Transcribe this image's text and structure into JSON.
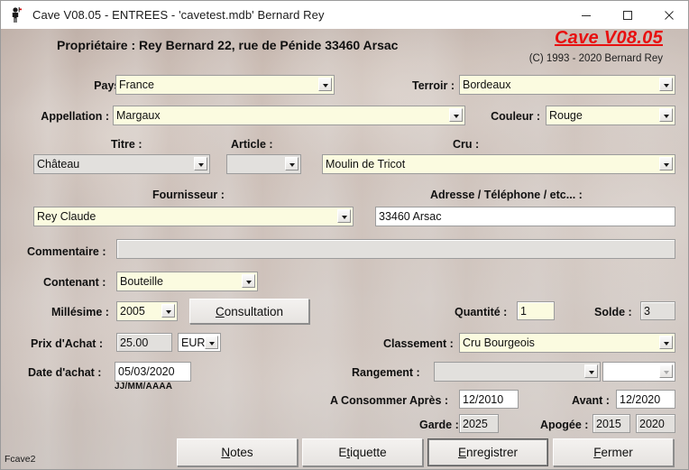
{
  "window": {
    "title": "Cave V08.05  - ENTREES -  'cavetest.mdb'   Bernard Rey",
    "app_icon": "person-icon",
    "minimize": "minimize-icon",
    "maximize": "maximize-icon",
    "close": "close-icon"
  },
  "header": {
    "owner": "Propriétaire : Rey Bernard 22, rue de Pénide 33460 Arsac",
    "logo": "Cave V08.05",
    "logo_color": "#e81010",
    "copyright": "(C) 1993 - 2020 Bernard Rey"
  },
  "form": {
    "pays": {
      "label": "Pays :",
      "value": "France"
    },
    "terroir": {
      "label": "Terroir :",
      "value": "Bordeaux"
    },
    "appellation": {
      "label": "Appellation :",
      "value": "Margaux"
    },
    "couleur": {
      "label": "Couleur :",
      "value": "Rouge"
    },
    "titre": {
      "label": "Titre :",
      "value": "Château"
    },
    "article": {
      "label": "Article :",
      "value": ""
    },
    "cru": {
      "label": "Cru :",
      "value": "Moulin de Tricot"
    },
    "fournisseur": {
      "label": "Fournisseur :",
      "value": "Rey Claude"
    },
    "adresse": {
      "label": "Adresse / Téléphone / etc... :",
      "value": "33460 Arsac"
    },
    "commentaire": {
      "label": "Commentaire :",
      "value": ""
    },
    "contenant": {
      "label": "Contenant :",
      "value": "Bouteille"
    },
    "millesime": {
      "label": "Millésime :",
      "value": "2005"
    },
    "consultation": {
      "label_before": "C",
      "label_after": "onsultation"
    },
    "quantite": {
      "label": "Quantité :",
      "value": "1"
    },
    "solde": {
      "label": "Solde :",
      "value": "3"
    },
    "prix": {
      "label": "Prix d'Achat :",
      "value": "25.00"
    },
    "devise": {
      "value": "EUR"
    },
    "classement": {
      "label": "Classement :",
      "value": "Cru Bourgeois"
    },
    "date_achat": {
      "label": "Date d'achat :",
      "value": "05/03/2020",
      "hint": "JJ/MM/AAAA"
    },
    "rangement": {
      "label": "Rangement :",
      "value": "",
      "value2": ""
    },
    "consommer_apres": {
      "label": "A Consommer Après :",
      "value": "12/2010"
    },
    "avant": {
      "label": "Avant :",
      "value": "12/2020"
    },
    "garde": {
      "label": "Garde :",
      "value": "2025"
    },
    "apogee": {
      "label": "Apogée :",
      "value": "2015",
      "value2": "2020"
    }
  },
  "buttons": {
    "notes": {
      "pre": "",
      "key": "N",
      "post": "otes"
    },
    "etiquette": {
      "pre": "E",
      "key": "t",
      "post": "iquette"
    },
    "enregistrer": {
      "pre": "",
      "key": "E",
      "post": "nregistrer"
    },
    "fermer": {
      "pre": "",
      "key": "F",
      "post": "ermer"
    }
  },
  "status": {
    "form_id": "Fcave2"
  }
}
